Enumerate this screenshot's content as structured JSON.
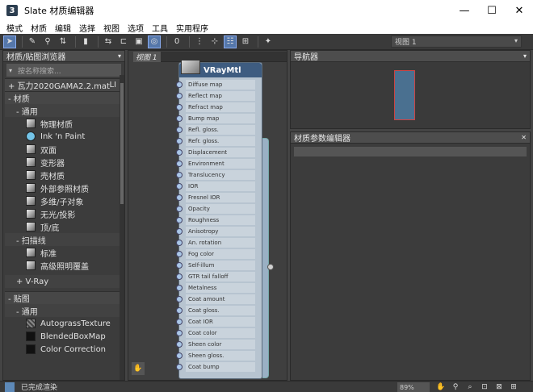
{
  "window": {
    "title": "Slate 材质编辑器",
    "app_icon_glyph": "3",
    "controls": {
      "minimize": "—",
      "maximize": "☐",
      "close": "✕"
    }
  },
  "menu": [
    "模式",
    "材质",
    "编辑",
    "选择",
    "视图",
    "选项",
    "工具",
    "实用程序"
  ],
  "toolbar": {
    "view_select": "视图 1"
  },
  "browser": {
    "title": "材质/贴图浏览器",
    "search_placeholder": "按名称搜索...",
    "file_entry": "+ 瓦力2020GAMA2.2.mat",
    "file_suffix": "LI",
    "groups": [
      {
        "label": "- 材质"
      },
      {
        "label": "- 通用"
      }
    ],
    "general_items": [
      {
        "label": "物理材质",
        "icon": "sphere"
      },
      {
        "label": "Ink 'n Paint",
        "icon": "ink"
      },
      {
        "label": "双面",
        "icon": "sphere"
      },
      {
        "label": "变形器",
        "icon": "sphere"
      },
      {
        "label": "壳材质",
        "icon": "sphere"
      },
      {
        "label": "外部参照材质",
        "icon": "sphere"
      },
      {
        "label": "多维/子对象",
        "icon": "sphere"
      },
      {
        "label": "无光/投影",
        "icon": "sphere"
      },
      {
        "label": "顶/底",
        "icon": "sphere"
      }
    ],
    "scanline_group": "- 扫描线",
    "scanline_items": [
      {
        "label": "标准",
        "icon": "sphere"
      },
      {
        "label": "高级照明覆盖",
        "icon": "sphere"
      }
    ],
    "vray_group": "+ V-Ray",
    "maps_group": "- 贴图",
    "maps_general": "- 通用",
    "map_items": [
      {
        "label": "AutograssTexture",
        "icon": "tex"
      },
      {
        "label": "BlendedBoxMap",
        "icon": "dark"
      },
      {
        "label": "Color Correction",
        "icon": "dark"
      }
    ]
  },
  "view": {
    "tab_label": "视图 1",
    "node": {
      "title": "VRayMtl",
      "slots": [
        "Diffuse map",
        "Reflect map",
        "Refract map",
        "Bump map",
        "Refl. gloss.",
        "Refr. gloss.",
        "Displacement",
        "Environment",
        "Translucency",
        "IOR",
        "Fresnel IOR",
        "Opacity",
        "Roughness",
        "Anisotropy",
        "An. rotation",
        "Fog color",
        "Self-illum",
        "GTR tail falloff",
        "Metalness",
        "Coat amount",
        "Coat gloss.",
        "Coat IOR",
        "Coat color",
        "Sheen color",
        "Sheen gloss.",
        "Coat bump"
      ]
    }
  },
  "navigator": {
    "title": "导航器"
  },
  "params": {
    "title": "材质参数编辑器"
  },
  "status": {
    "text": "已完成渲染",
    "zoom": "89%"
  }
}
